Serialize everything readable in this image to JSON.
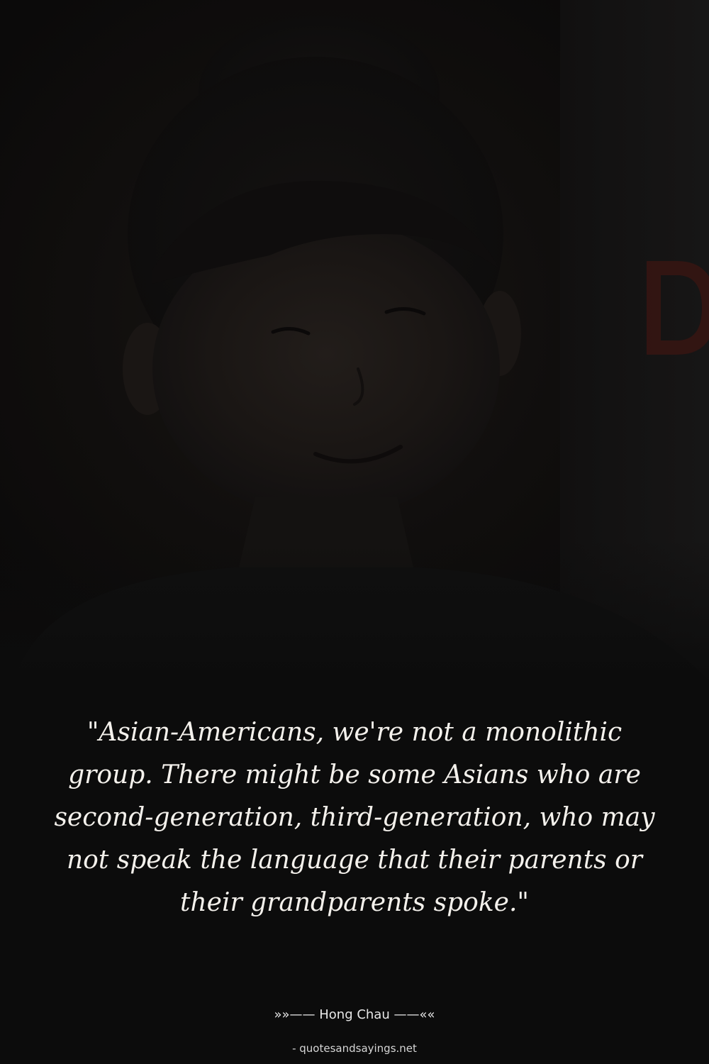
{
  "quote": {
    "text": "\"Asian-Americans, we're not a monolithic group. There might be some Asians who are second-generation, third-generation, who may not speak the language that their parents or their grandparents spoke.\""
  },
  "attribution": {
    "text": "»»—— Hong Chau ——««"
  },
  "source": {
    "text": "- quotesandsayings.net"
  },
  "colors": {
    "background": "#0c0c0c",
    "quote_text": "#f4f1ec",
    "sign_letter": "#3a1512"
  }
}
